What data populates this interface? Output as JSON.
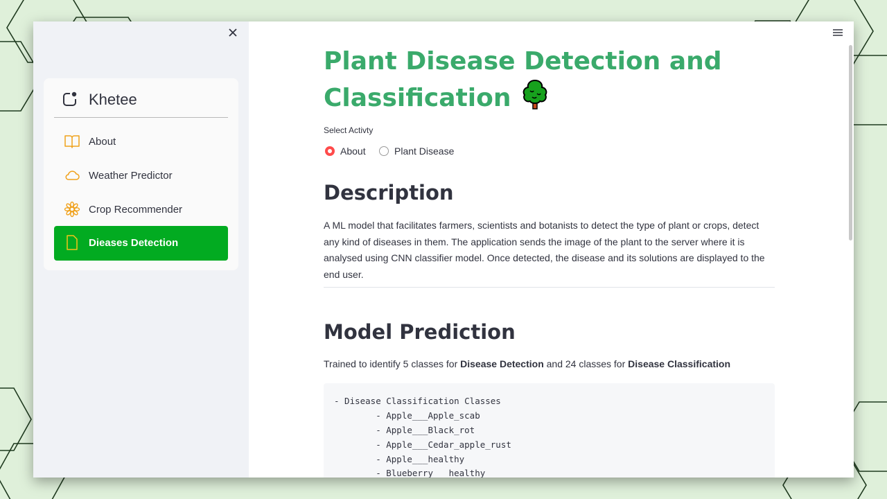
{
  "sidebar": {
    "brand_title": "Khetee",
    "items": [
      {
        "label": "About",
        "icon": "book-icon"
      },
      {
        "label": "Weather Predictor",
        "icon": "cloud-icon"
      },
      {
        "label": "Crop Recommender",
        "icon": "flower-icon"
      },
      {
        "label": "Dieases Detection",
        "icon": "file-icon",
        "active": true
      }
    ]
  },
  "main": {
    "title_line1": "Plant Disease Detection and",
    "title_line2": "Classification",
    "activity_label": "Select Activty",
    "radio_options": [
      {
        "label": "About",
        "checked": true
      },
      {
        "label": "Plant Disease",
        "checked": false
      }
    ],
    "description_heading": "Description",
    "description_text": "A ML model that facilitates farmers, scientists and botanists to detect the type of plant or crops, detect any kind of diseases in them. The application sends the image of the plant to the server where it is analysed using CNN classifier model. Once detected, the disease and its solutions are displayed to the end user.",
    "model_heading": "Model Prediction",
    "trained_prefix": "Trained to identify 5 classes for ",
    "trained_bold1": "Disease Detection",
    "trained_mid": " and 24 classes for ",
    "trained_bold2": "Disease Classification",
    "code_lines": [
      "- Disease Classification Classes",
      "        - Apple___Apple_scab",
      "        - Apple___Black_rot",
      "        - Apple___Cedar_apple_rust",
      "        - Apple___healthy",
      "        - Blueberry___healthy"
    ]
  },
  "colors": {
    "accent_green": "#02ab21",
    "title_green": "#3aaa6b",
    "radio_red": "#ff4b4b",
    "nav_icon_orange": "#f0a11b"
  }
}
